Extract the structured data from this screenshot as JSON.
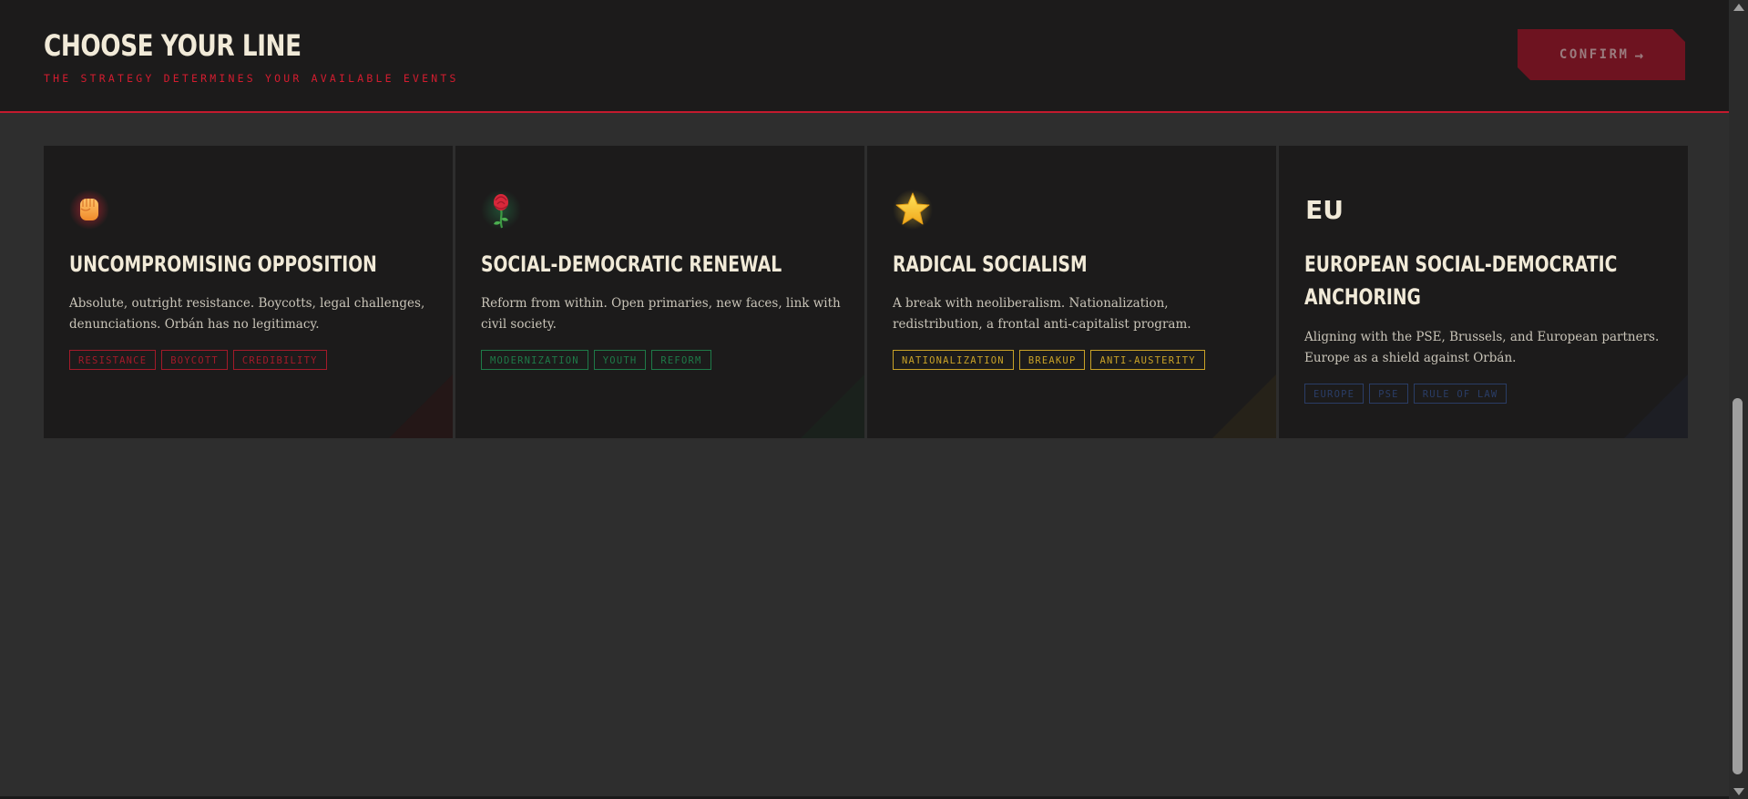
{
  "header": {
    "title": "CHOOSE YOUR LINE",
    "subtitle": "THE STRATEGY DETERMINES YOUR AVAILABLE EVENTS",
    "confirm_label": "CONFIRM",
    "confirm_arrow": "→",
    "accent_color": "#c41a2e"
  },
  "cards": [
    {
      "icon": "raised-fist-icon",
      "title": "UNCOMPROMISING OPPOSITION",
      "description": "Absolute, outright resistance. Boycotts, legal challenges, denunciations. Orbán has no legitimacy.",
      "tags": [
        "RESISTANCE",
        "BOYCOTT",
        "CREDIBILITY"
      ],
      "tag_color": "#a31a29"
    },
    {
      "icon": "rose-icon",
      "title": "SOCIAL-DEMOCRATIC RENEWAL",
      "description": "Reform from within. Open primaries, new faces, link with civil society.",
      "tags": [
        "MODERNIZATION",
        "YOUTH",
        "REFORM"
      ],
      "tag_color": "#1e7a48"
    },
    {
      "icon": "star-icon",
      "title": "RADICAL SOCIALISM",
      "description": "A break with neoliberalism. Nationalization, redistribution, a frontal anti-capitalist program.",
      "tags": [
        "NATIONALIZATION",
        "BREAKUP",
        "ANTI-AUSTERITY"
      ],
      "tag_color": "#c9a227"
    },
    {
      "icon": "eu-icon",
      "icon_text": "EU",
      "title": "EUROPEAN SOCIAL-DEMOCRATIC ANCHORING",
      "description": "Aligning with the PSE, Brussels, and European partners. Europe as a shield against Orbán.",
      "tags": [
        "EUROPE",
        "PSE",
        "RULE OF LAW"
      ],
      "tag_color": "#2a3d66"
    }
  ]
}
